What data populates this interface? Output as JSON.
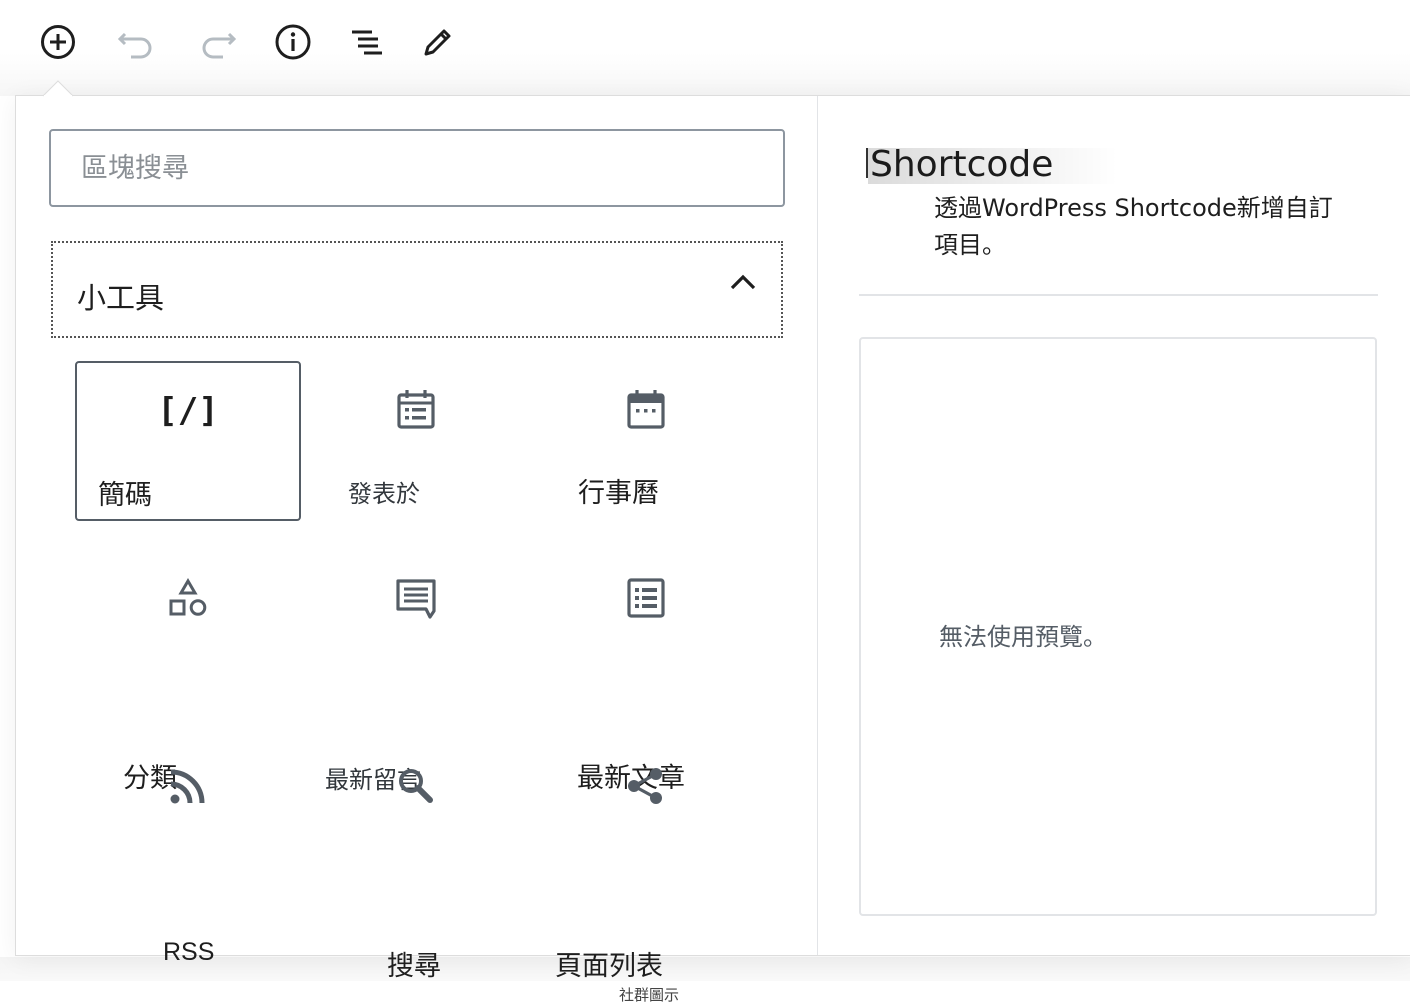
{
  "toolbar": {
    "buttons": [
      {
        "name": "add-block",
        "icon": "plus-circle-icon"
      },
      {
        "name": "undo",
        "icon": "undo-icon"
      },
      {
        "name": "redo",
        "icon": "redo-icon"
      },
      {
        "name": "info",
        "icon": "info-icon"
      },
      {
        "name": "list-view",
        "icon": "list-view-icon"
      },
      {
        "name": "edit",
        "icon": "pencil-icon"
      }
    ]
  },
  "inserter": {
    "search_placeholder": "區塊搜尋",
    "panel_title": "小工具",
    "blocks": [
      {
        "label": "簡碼",
        "icon": "shortcode-icon",
        "icon_text": "[/]"
      },
      {
        "label": "發表於",
        "icon": "archive-calendar-icon"
      },
      {
        "label": "行事曆",
        "icon": "calendar-icon"
      },
      {
        "label": "分類",
        "icon": "categories-icon"
      },
      {
        "label": "最新留言",
        "icon": "comment-icon"
      },
      {
        "label": "最新文章",
        "icon": "post-list-icon"
      },
      {
        "label": "RSS",
        "icon": "rss-icon"
      },
      {
        "label": "搜尋",
        "icon": "search-icon"
      },
      {
        "label": "頁面列表",
        "icon": "share-icon",
        "sub_label": "社群圖示"
      }
    ]
  },
  "preview": {
    "title": "Shortcode",
    "description": "透過WordPress Shortcode新增自訂項目。",
    "empty_message": "無法使用預覽。"
  },
  "colors": {
    "icon": "#555d66",
    "border": "#8d96a0",
    "divider": "#e2e4e7"
  }
}
